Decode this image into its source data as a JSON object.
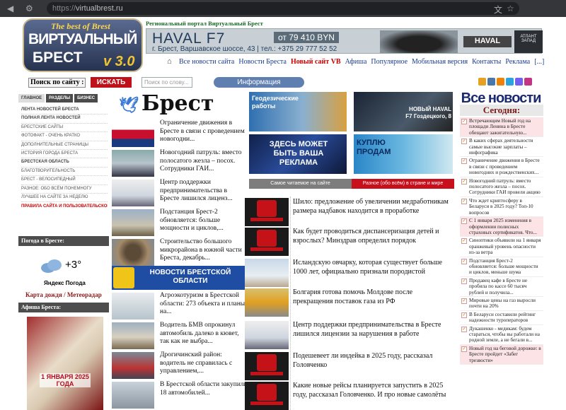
{
  "browser": {
    "url_protocol": "https://",
    "url_host": "virtualbrest.ru"
  },
  "header": {
    "logo_tagline": "The best of Brest",
    "logo_line1": "ВИРТУАЛЬНЫЙ",
    "logo_line2": "БРЕСТ",
    "logo_version": "v 3.0",
    "portal_title": "Региональный портал Виртуальный Брест",
    "banner": {
      "model": "HAVAL F7",
      "price": "от 79 410 BYN",
      "address": "г. Брест, Варшавское шоссе, 43 | тел.: +375 29 777 52 52",
      "brand": "HAVAL",
      "dealer": "АТЛАНТ ЗАПАД"
    },
    "nav": [
      "Все новости сайта",
      "Новости Бреста",
      "Новый сайт VB",
      "Афиша",
      "Популярное",
      "Мобильная версия",
      "Контакты",
      "Реклама",
      "[...]"
    ]
  },
  "search": {
    "label": "Поиск по сайту :",
    "button": "ИСКАТЬ",
    "placeholder": "Поиск по слову...",
    "info_button": "Информация рекламодателю"
  },
  "sidebar": {
    "tabs": [
      "ГЛАВНОЕ",
      "РАЗДЕЛЫ",
      "БИЗНЕС"
    ],
    "items": [
      "ЛЕНТА НОВОСТЕЙ БРЕСТА",
      "ПОЛНАЯ ЛЕНТА НОВОСТЕЙ",
      "БРЕСТСКИЕ САЙТЫ",
      "ФОТОФАКТ - ОЧЕНЬ КРАТКО",
      "ДОПОЛНИТЕЛЬНЫЕ СТРАНИЦЫ",
      "ИСТОРИЯ ГОРОДА БРЕСТА",
      "БРЕСТСКАЯ ОБЛАСТЬ",
      "БЛАГОТВОРИТЕЛЬНОСТЬ",
      "БРЕСТ - ВЕЛОСИПЕДНЫЙ",
      "РАЗНОЕ: ОБО ВСЁМ ПОНЕМНОГУ",
      "ЛУЧШЕЕ НА САЙТЕ ЗА НЕДЕЛЮ"
    ],
    "rules": "ПРАВИЛА САЙТА И ПОЛЬЗОВАТЕЛЬСКОЕ СОГЛАШЕНИЕ",
    "weather_heading": "Погода в Бресте:",
    "weather_temp": "+3°",
    "weather_source": "Яндекс Погода",
    "weather_link1": "Карта дождя",
    "weather_sep": "/",
    "weather_link2": "Метеорадар",
    "afisha_heading": "Афиша Бреста:",
    "afisha_text": "1 ЯНВАРЯ 2025 ГОДА"
  },
  "center": {
    "city_logo": "Брест",
    "news": [
      "Ограничение движения в Бресте в связи с проведением новогодни...",
      "Новогодний патруль: вместо полосатого жезла – посох. Сотрудники ГАИ...",
      "Центр поддержки предпринимательства в Бресте лишился лиценз...",
      "Подстанция Брест-2 обновляется: больше мощности и циклов,...",
      "Строительство большого микрорайона в южной части Бреста, декабрь..."
    ],
    "oblast_banner": "НОВОСТИ БРЕСТСКОЙ ОБЛАСТИ",
    "oblast_news": [
      "Агроэкотуризм в Брестской области: 273 объекта и планы на...",
      "Водитель БМВ опрокинул автомобиль далеко в кювет, так как не выбра...",
      "Дрогичинский район: водитель не справилась с управлением,...",
      "В Брестской области закупили 18 автомобилей..."
    ]
  },
  "ads": {
    "geo": "Геодезические работы",
    "haval_small": "НОВЫЙ HAVAL F7 Гоздецкого, 8",
    "your_ad": "ЗДЕСЬ МОЖЕТ БЫТЬ ВАША РЕКЛАМА",
    "buy_sell": "КУПЛЮ ПРОДАМ"
  },
  "tabs_bar": {
    "left": "Самое читаемое на сайте",
    "right": "Разное (обо всём) в стране и мире"
  },
  "feed": [
    "Шило: предложение об увеличении медработникам размера надбавок находится в проработке",
    "Как будет проводиться диспансеризация детей и взрослых? Минздрав определил порядок",
    "Исландскую овчарку, которая существует больше 1000 лет, официально признали породистой",
    "Болгария готова помочь Молдове после прекращения поставок газа из РФ",
    "Центр поддержки предпринимательства в Бресте лишился лицензии за нарушения в работе",
    "Подешевеет ли индейка в 2025 году, рассказал Головченко",
    "Какие новые рейсы планируется запустить в 2025 году, рассказал Головченко. И про новые самолёты"
  ],
  "right": {
    "title": "Все новости",
    "subtitle": "Сегодня:",
    "items": [
      {
        "text": "Встречающим Новый год на площади Ленина в Бресте обещают зажигательную...",
        "pink": true
      },
      {
        "text": "В каких сферах деятельности самые высокие зарплаты – инфографика",
        "pink": false
      },
      {
        "text": "Ограничение движения в Бресте в связи с проведением новогодних и рождественских...",
        "pink": false
      },
      {
        "text": "Новогодний патруль: вместо полосатого жезла – посох. Сотрудники ГАИ провели акцию",
        "pink": false
      },
      {
        "text": "Что ждет криптосферу в Беларуси в 2025 году? Топ-10 вопросов",
        "pink": false
      },
      {
        "text": "С 1 января 2025 изменения в оформлении полисных страховых сертификатов. Что...",
        "pink": true
      },
      {
        "text": "Синоптики объявили на 1 января оранжевый уровень опасности из-за ветра",
        "pink": false
      },
      {
        "text": "Подстанция Брест-2 обновляется: больше мощности и циклов, меньше шума",
        "pink": false
      },
      {
        "text": "Продавец кафе в Бресте не пробила по кассе 60 тысяч рублей и получила...",
        "pink": false
      },
      {
        "text": "Мировые цены на газ выросли почти на 20%",
        "pink": false
      },
      {
        "text": "В Беларуси составили рейтинг надежности туроператоров",
        "pink": false
      },
      {
        "text": "Дукашенко - медикам: будем стараться, чтобы вы работали на родной земле, а не бегали в...",
        "pink": false
      },
      {
        "text": "Новый год на беговой дорожке: в Бресте пройдет «Забег трезвости»",
        "pink": true
      }
    ]
  }
}
